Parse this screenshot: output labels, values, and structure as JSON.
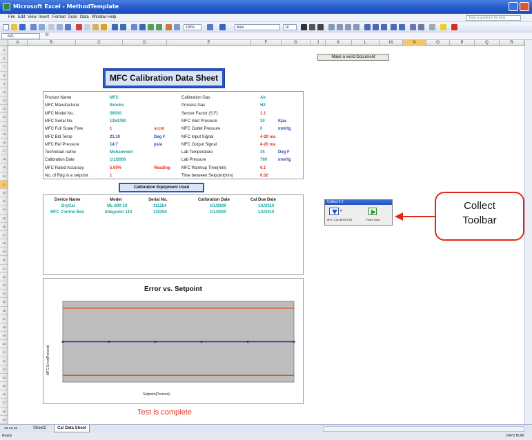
{
  "window": {
    "title": "Microsoft Excel - MethodTemplate"
  },
  "menu": {
    "items": [
      "File",
      "Edit",
      "View",
      "Insert",
      "Format",
      "Tools",
      "Data",
      "Window",
      "Help"
    ],
    "help_placeholder": "Type a question for help"
  },
  "toolbar": {
    "zoom": "100%",
    "font": "Arial",
    "font_size": "10"
  },
  "formula": {
    "cell_ref": "N21",
    "fx": "fx"
  },
  "columns": [
    "A",
    "B",
    "C",
    "D",
    "E",
    "F",
    "G",
    "J",
    "K",
    "L",
    "M",
    "N",
    "O",
    "P",
    "Q",
    "R"
  ],
  "selected_column": "N",
  "rows": [
    "5",
    "6",
    "7",
    "8",
    "9",
    "10",
    "11",
    "12",
    "13",
    "14",
    "15",
    "16",
    "17",
    "18",
    "19",
    "20",
    "21",
    "22",
    "23",
    "24",
    "25",
    "26",
    "27",
    "28",
    "29",
    "30",
    "31",
    "32",
    "33",
    "34",
    "35",
    "36",
    "37",
    "38",
    "39",
    "40",
    "41",
    "42",
    "43",
    "44",
    "45",
    "46",
    "47",
    "48",
    "49"
  ],
  "selected_row": "21",
  "word_button": "Make a word Document",
  "sheet_title": "MFC Calibration Data Sheet",
  "info_left": [
    {
      "label": "Product Name",
      "value": "MFC",
      "unit": ""
    },
    {
      "label": "MFC Manufacturer",
      "value": "Brooks",
      "unit": ""
    },
    {
      "label": "MFC Model No.",
      "value": "5850S",
      "unit": ""
    },
    {
      "label": "MFC Serial No.",
      "value": "1254789",
      "unit": ""
    },
    {
      "label": "MFC Full Scale Flow",
      "value": "1",
      "unit": "sccm"
    },
    {
      "label": "MFC Bld Temp",
      "value": "21.10",
      "unit": "Deg F"
    },
    {
      "label": "MFC Ref Pressure",
      "value": "14.7",
      "unit": "psia"
    },
    {
      "label": "Technician name",
      "value": "Mohammed",
      "unit": ""
    },
    {
      "label": "Calibration Date",
      "value": "1/1/2009",
      "unit": ""
    },
    {
      "label": "MFC Rated Accuracy",
      "value": "5.00%",
      "unit": "Reading"
    },
    {
      "label": "No. of Rdg in a setpoint",
      "value": "1",
      "unit": ""
    }
  ],
  "info_right": [
    {
      "label": "Calibration Gas",
      "value": "Air",
      "unit": ""
    },
    {
      "label": "Process Gas",
      "value": "H2",
      "unit": ""
    },
    {
      "label": "Sensor Factor (S.F)",
      "value": "1.1",
      "unit": ""
    },
    {
      "label": "MFC Inlet Pressure",
      "value": "30",
      "unit": "Kpa"
    },
    {
      "label": "MFC Outlet Pressure",
      "value": "0",
      "unit": "mmHg"
    },
    {
      "label": "MFC Input Signal",
      "value": "4-20 ma",
      "unit": ""
    },
    {
      "label": "MFC Output Signal",
      "value": "4-20 ma",
      "unit": ""
    },
    {
      "label": "Lab Temperature",
      "value": "35",
      "unit": "Deg F"
    },
    {
      "label": "Lab Pressure",
      "value": "760",
      "unit": "mmHg"
    },
    {
      "label": "MFC Warmup Time(min)",
      "value": "0.1",
      "unit": ""
    },
    {
      "label": "Time between Setpoint(min)",
      "value": "0.02",
      "unit": ""
    }
  ],
  "equipment": {
    "title": "Calibration Equipment Used",
    "headers": [
      "Device Name",
      "Model",
      "Serial No.",
      "Calibration Date",
      "Cal Due Date"
    ],
    "rows": [
      [
        "DryCal",
        "ML-800-10",
        "111254",
        "1/1/2009",
        "1/1/2010"
      ],
      [
        "MFC Control Box",
        "Integrator 110",
        "110250",
        "1/1/2009",
        "1/1/2010"
      ]
    ]
  },
  "chart_data": {
    "type": "line",
    "title": "Error vs. Setpoint",
    "xlabel": "Setpoint(Percent)",
    "ylabel": "MFC Error(Percent)",
    "series": [
      {
        "color": "#e8541c",
        "x": [
          0,
          100
        ],
        "values": [
          5,
          5
        ]
      },
      {
        "color": "#e8541c",
        "x": [
          0,
          100
        ],
        "values": [
          -5,
          -5
        ]
      },
      {
        "color": "#1c2e8c",
        "x": [
          0,
          20,
          40,
          60,
          80,
          100
        ],
        "values": [
          0,
          0,
          0,
          0,
          0,
          0
        ]
      }
    ],
    "plot_bg": "#bdbdbd",
    "ylim": [
      -6,
      6
    ],
    "xlim": [
      0,
      100
    ]
  },
  "status_message": "Test is complete",
  "collect_toolbar": {
    "title": "Collect 6.2",
    "buttons": [
      "MFC CALIBRATION",
      "Place Data"
    ]
  },
  "callout": {
    "line1": "Collect",
    "line2": "Toolbar"
  },
  "sheet_tabs": [
    "Sheet2",
    "Cal Data Sheet"
  ],
  "status": {
    "left": "Ready",
    "right": "CAPS NUM"
  }
}
